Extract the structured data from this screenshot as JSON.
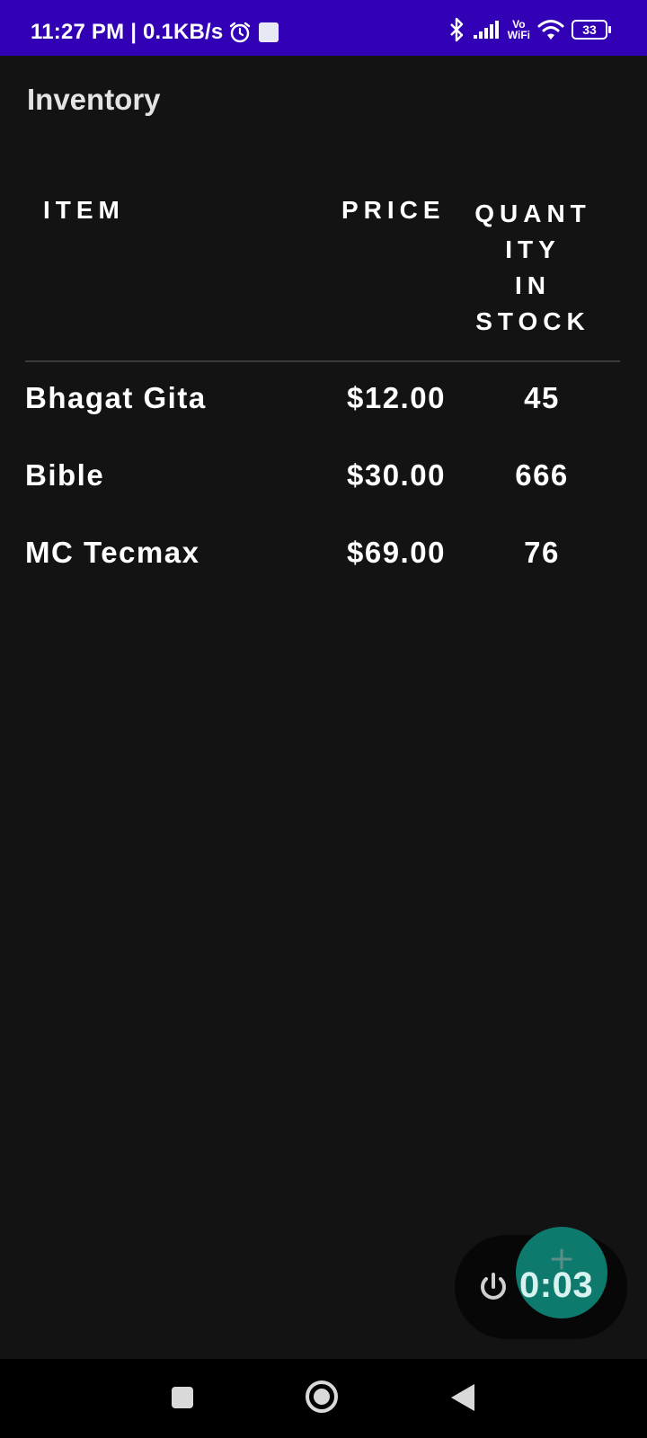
{
  "status_bar": {
    "time_speed": "11:27 PM | 0.1KB/s",
    "vowifi_top": "Vo",
    "vowifi_bottom": "WiFi",
    "battery": "33",
    "icons": [
      "alarm-icon",
      "gallery-icon",
      "bluetooth-icon",
      "signal-icon",
      "wifi-icon",
      "battery-icon"
    ]
  },
  "app": {
    "title": "Inventory"
  },
  "table": {
    "headers": {
      "item": "ITEM",
      "price": "PRICE",
      "quantity": "QUANT\nITY\nIN\nSTOCK"
    },
    "rows": [
      {
        "name": "Bhagat Gita",
        "price": "$12.00",
        "quantity": "45"
      },
      {
        "name": "Bible",
        "price": "$30.00",
        "quantity": "666"
      },
      {
        "name": "MC Tecmax",
        "price": "$69.00",
        "quantity": "76"
      }
    ]
  },
  "floating_widget": {
    "timer": "0:03",
    "icons": [
      "power-icon",
      "plus-icon"
    ]
  },
  "nav_bar": {
    "icons": [
      "recent-apps-icon",
      "home-icon",
      "back-icon"
    ]
  },
  "colors": {
    "status_bar": "#3200b5",
    "background": "#131313",
    "fab": "#0e7a6d",
    "nav_bar": "#000000"
  }
}
